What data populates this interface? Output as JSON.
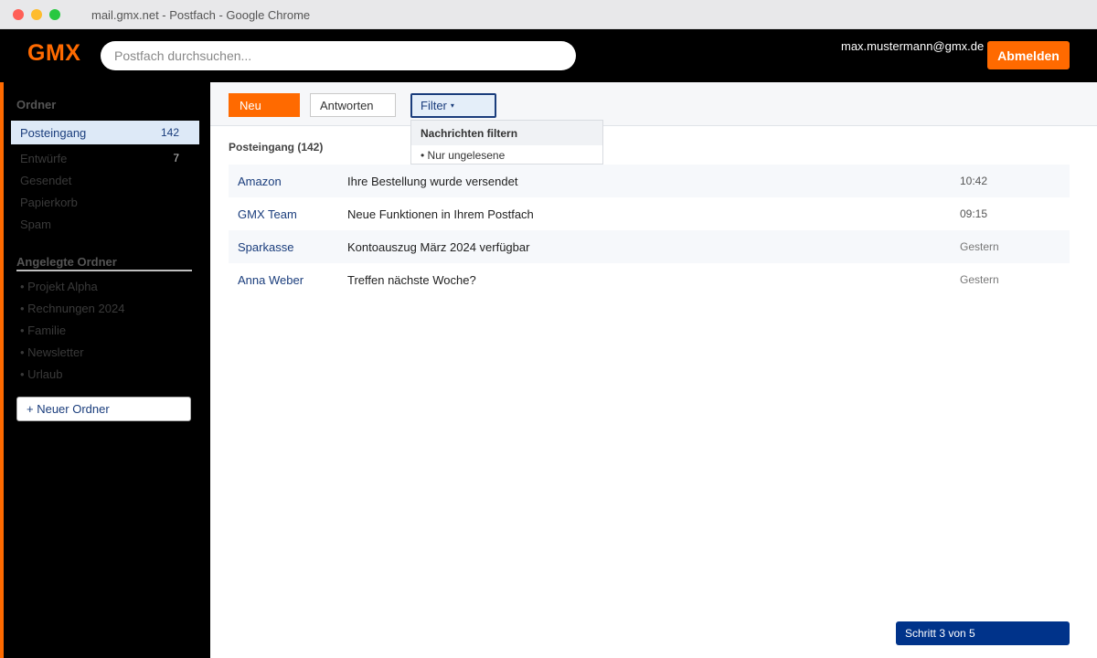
{
  "window": {
    "title": "mail.gmx.net - Postfach - Google Chrome"
  },
  "header": {
    "logo": "GMX",
    "search_placeholder": "Postfach durchsuchen...",
    "user_email": "max.mustermann@gmx.de",
    "logout_label": "Abmelden"
  },
  "sidebar": {
    "folders_heading": "Ordner",
    "folders": [
      {
        "label": "Posteingang",
        "count": "142",
        "active": true
      },
      {
        "label": "Entwürfe",
        "count": "7"
      },
      {
        "label": "Gesendet"
      },
      {
        "label": "Papierkorb"
      },
      {
        "label": "Spam"
      }
    ],
    "custom_heading": "Angelegte Ordner",
    "custom_folders": [
      {
        "label": "• Projekt Alpha"
      },
      {
        "label": "• Rechnungen 2024"
      },
      {
        "label": "• Familie"
      },
      {
        "label": "• Newsletter"
      },
      {
        "label": "• Urlaub"
      }
    ],
    "new_folder_label": "+ Neuer Ordner"
  },
  "toolbar": {
    "new_label": "Neu",
    "reply_label": "Antworten",
    "filter_label": "Filter",
    "filter_caret": "▾"
  },
  "filter_menu": {
    "heading": "Nachrichten filtern",
    "items": [
      "• Nur ungelesene"
    ]
  },
  "inbox": {
    "title": "Posteingang (142)",
    "messages": [
      {
        "from": "Amazon",
        "subject": "Ihre Bestellung wurde versendet",
        "time": "10:42"
      },
      {
        "from": "GMX Team",
        "subject": "Neue Funktionen in Ihrem Postfach",
        "time": "09:15"
      },
      {
        "from": "Sparkasse",
        "subject": "Kontoauszug März 2024 verfügbar",
        "time": "Gestern"
      },
      {
        "from": "Anna Weber",
        "subject": "Treffen nächste Woche?",
        "time": "Gestern"
      }
    ]
  },
  "step_indicator": "Schritt 3 von 5",
  "colors": {
    "brand_orange": "#ff6a00",
    "link_blue": "#1a3d7c",
    "step_blue": "#00338a"
  }
}
